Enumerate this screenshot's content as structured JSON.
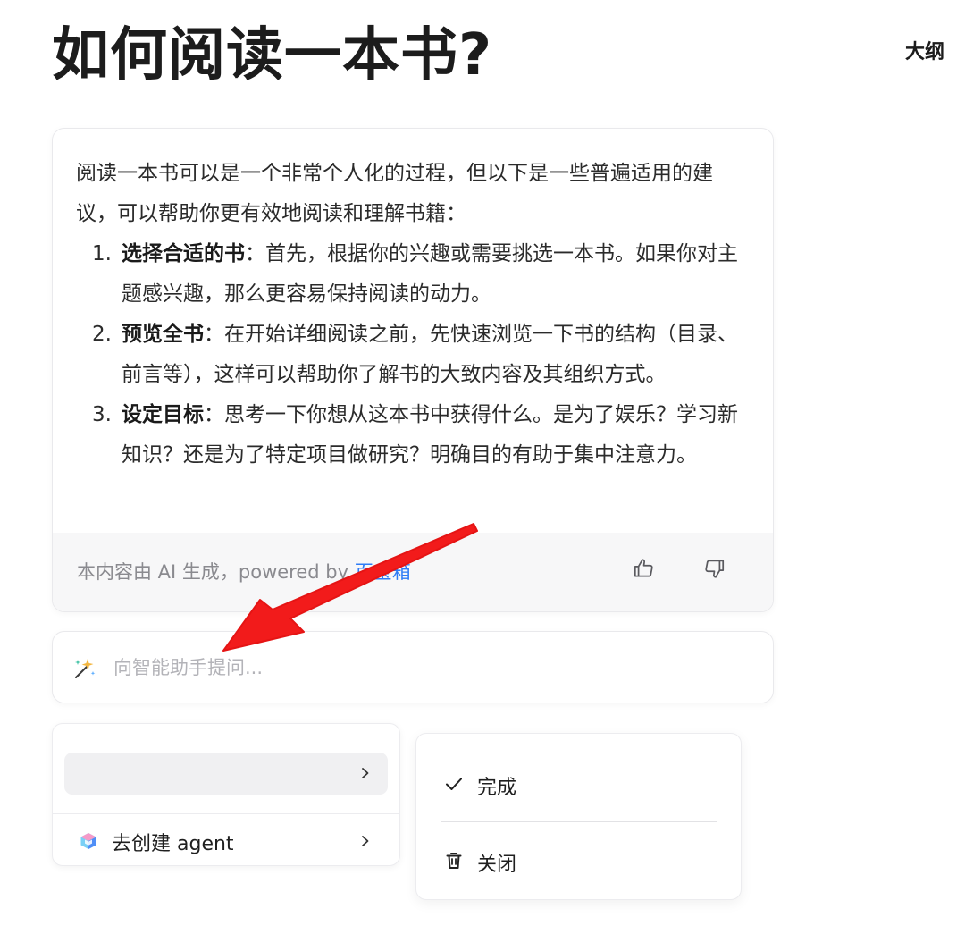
{
  "page": {
    "title": "如何阅读一本书?",
    "outline_label": "大纲"
  },
  "ai_answer": {
    "intro": "阅读一本书可以是一个非常个人化的过程，但以下是一些普遍适用的建议，可以帮助你更有效地阅读和理解书籍：",
    "items": [
      {
        "num": "1.",
        "bold": "选择合适的书",
        "text": "：首先，根据你的兴趣或需要挑选一本书。如果你对主题感兴趣，那么更容易保持阅读的动力。"
      },
      {
        "num": "2.",
        "bold": "预览全书",
        "text": "：在开始详细阅读之前，先快速浏览一下书的结构（目录、前言等），这样可以帮助你了解书的大致内容及其组织方式。"
      },
      {
        "num": "3.",
        "bold": "设定目标",
        "text": "：思考一下你想从这本书中获得什么。是为了娱乐？学习新知识？还是为了特定项目做研究？明确目的有助于集中注意力。"
      }
    ],
    "footer_prefix": "本内容由 AI 生成，powered by ",
    "footer_link": "百宝箱"
  },
  "ask": {
    "placeholder": "向智能助手提问..."
  },
  "menu": {
    "agent_label": "去创建 agent"
  },
  "actions": {
    "done_label": "完成",
    "close_label": "关闭"
  },
  "icons": {
    "thumbs_up": "thumbs-up-icon",
    "thumbs_down": "thumbs-down-icon",
    "magic_wand": "magic-wand-icon",
    "chevron": "chevron-right-icon",
    "agent": "agent-cube-icon",
    "check": "check-icon",
    "trash": "trash-icon",
    "arrow": "red-arrow-icon"
  },
  "colors": {
    "link": "#2f7cf6",
    "annotation_arrow": "#f21b1b"
  }
}
